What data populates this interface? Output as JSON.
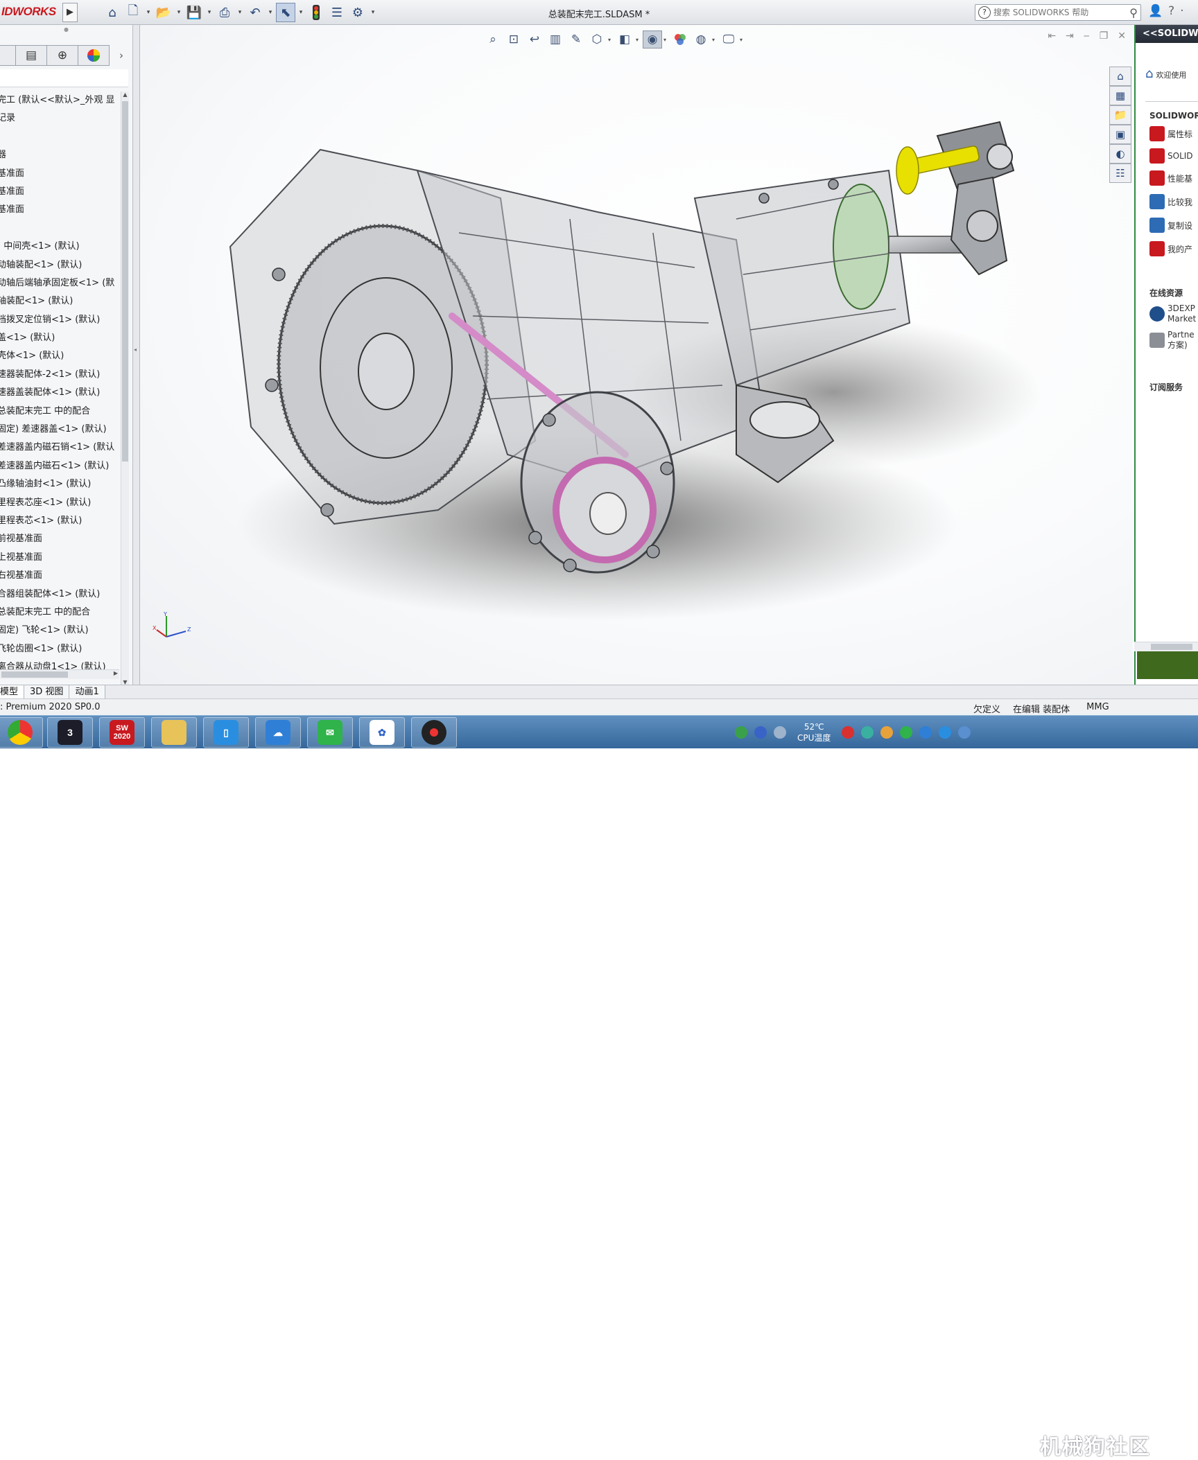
{
  "app": {
    "logo_text": "IDWORKS",
    "document_title": "总装配末完工.SLDASM *",
    "search_placeholder": "搜索 SOLIDWORKS 帮助"
  },
  "toolbar": {
    "icons": [
      "home-icon",
      "new-file-icon",
      "open-file-icon",
      "save-icon",
      "print-icon",
      "undo-icon",
      "select-pointer-icon",
      "rebuild-traffic-light-icon",
      "file-properties-icon",
      "options-gear-icon"
    ]
  },
  "heads_up_toolbar": {
    "icons": [
      "zoom-to-fit-icon",
      "zoom-to-area-icon",
      "previous-view-icon",
      "section-view-icon",
      "dynamic-annotation-icon",
      "view-orientation-icon",
      "display-style-icon",
      "hide-show-items-icon",
      "edit-appearance-icon",
      "apply-scene-icon",
      "view-settings-icon"
    ]
  },
  "feature_manager": {
    "tree_items": [
      "完工  (默认<<默认>_外观 显",
      "记录",
      "",
      "器",
      "基准面",
      "基准面",
      "基准面",
      "",
      ") 中间壳<1> (默认)",
      "动轴装配<1> (默认)",
      "动轴后端轴承固定板<1> (默",
      "轴装配<1> (默认)",
      "档拨叉定位销<1> (默认)",
      "盖<1> (默认)",
      "壳体<1> (默认)",
      "速器装配体-2<1> (默认)",
      "速器盖装配体<1> (默认)",
      "总装配末完工 中的配合",
      "固定) 差速器盖<1> (默认)",
      "差速器盖内磁石销<1> (默认",
      "差速器盖内磁石<1> (默认)",
      "凸缘轴油封<1> (默认)",
      "里程表芯座<1> (默认)",
      "里程表芯<1> (默认)",
      "前视基准面",
      "上视基准面",
      "右视基准面",
      "合器组装配体<1> (默认)",
      "总装配末完工 中的配合",
      "固定) 飞轮<1> (默认)",
      "飞轮齿圈<1> (默认)",
      "离合器从动盘1<1> (默认)"
    ]
  },
  "bottom_tabs": [
    "模型",
    "3D 视图",
    "动画1"
  ],
  "status": {
    "left": ": Premium 2020 SP0.0",
    "custom": "欠定义",
    "editing": "在编辑 装配体",
    "units": "MMG"
  },
  "task_pane": {
    "header": "<<SOLIDWORKS",
    "welcome": "欢迎使用",
    "section_solidworks": "SOLIDWOR",
    "items": [
      "属性标",
      "SOLID",
      "性能基",
      "比较我",
      "复制设",
      "我的产"
    ],
    "section_online": "在线资源",
    "online_items": [
      {
        "line1": "3DEXP",
        "line2": "Market"
      },
      {
        "line1": "Partne",
        "line2": "方案)"
      }
    ],
    "section_subscription": "订阅服务"
  },
  "taskbar": {
    "apps": [
      "browser",
      "3ds-max",
      "solidworks-2020",
      "file-explorer",
      "phone-link",
      "cloud-app",
      "wechat",
      "photos-app",
      "screen-recorder"
    ],
    "sw_badge": "2020",
    "temperature": "52℃",
    "temperature_label": "CPU温度",
    "watermark": "机械狗社区"
  },
  "colors": {
    "brand_red": "#c8191f",
    "taskbar_blue": "#4a7db0",
    "accent_yellow": "#e8e000",
    "accent_pink": "#c46ab0",
    "green_panel": "#3f6a1d"
  }
}
